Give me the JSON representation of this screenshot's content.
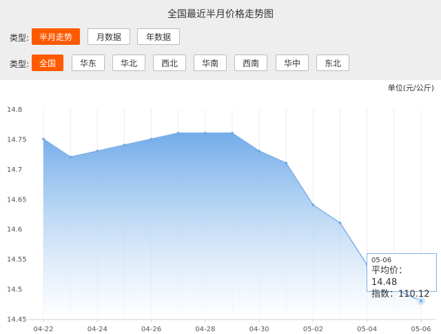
{
  "title": "全国最近半月价格走势图",
  "period_row": {
    "label": "类型:",
    "buttons": [
      {
        "label": "半月走势",
        "active": true
      },
      {
        "label": "月数据",
        "active": false
      },
      {
        "label": "年数据",
        "active": false
      }
    ]
  },
  "region_row": {
    "label": "类型:",
    "buttons": [
      {
        "label": "全国",
        "active": true
      },
      {
        "label": "华东",
        "active": false
      },
      {
        "label": "华北",
        "active": false
      },
      {
        "label": "西北",
        "active": false
      },
      {
        "label": "华南",
        "active": false
      },
      {
        "label": "西南",
        "active": false
      },
      {
        "label": "华中",
        "active": false
      },
      {
        "label": "东北",
        "active": false
      }
    ]
  },
  "unit_label": "单位(元/公斤)",
  "tooltip": {
    "date": "05-06",
    "avg_label": "平均价：",
    "avg_value": "14.48",
    "index_label": "指数：",
    "index_value": "110.12"
  },
  "chart_data": {
    "type": "area",
    "x": [
      "04-22",
      "04-23",
      "04-24",
      "04-25",
      "04-26",
      "04-27",
      "04-28",
      "04-29",
      "04-30",
      "05-01",
      "05-02",
      "05-03",
      "05-04",
      "05-05",
      "05-06"
    ],
    "values": [
      14.75,
      14.72,
      14.73,
      14.74,
      14.75,
      14.76,
      14.76,
      14.76,
      14.73,
      14.71,
      14.64,
      14.61,
      14.54,
      14.5,
      14.48
    ],
    "x_tick_labels": [
      "04-22",
      "04-24",
      "04-26",
      "04-28",
      "04-30",
      "05-02",
      "05-04",
      "05-06"
    ],
    "y_tick_labels": [
      "14.8",
      "14.75",
      "14.7",
      "14.65",
      "14.6",
      "14.55",
      "14.5",
      "14.45"
    ],
    "ylim": [
      14.45,
      14.8
    ],
    "grid": "vertical",
    "colors": {
      "fill_top": "#6aa8e8",
      "fill_bottom": "#ffffff",
      "line": "#7fb0e6",
      "accent": "#ff5a00"
    }
  }
}
